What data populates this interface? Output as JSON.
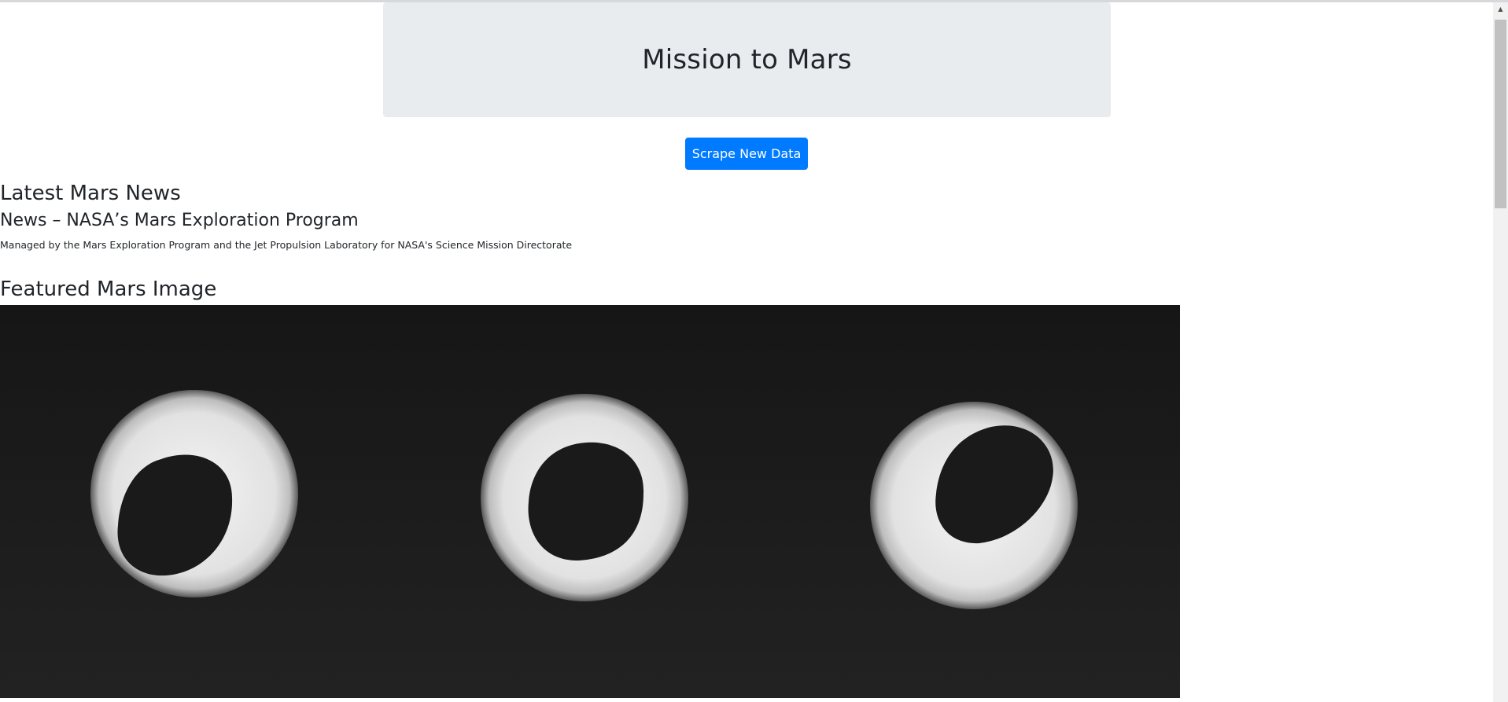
{
  "header": {
    "title": "Mission to Mars"
  },
  "actions": {
    "scrape_label": "Scrape New Data"
  },
  "news": {
    "section_title": "Latest Mars News",
    "title": "News – NASA’s Mars Exploration Program",
    "paragraph": "Managed by the Mars Exploration Program and the Jet Propulsion Laboratory for NASA's Science Mission Directorate"
  },
  "featured_image": {
    "section_title": "Featured Mars Image"
  },
  "colors": {
    "jumbotron_bg": "#e9ecef",
    "button_primary": "#007bff",
    "image_bg": "#1b1b1b"
  },
  "icons": {
    "scroll_up": "scroll-up-arrow-icon"
  }
}
